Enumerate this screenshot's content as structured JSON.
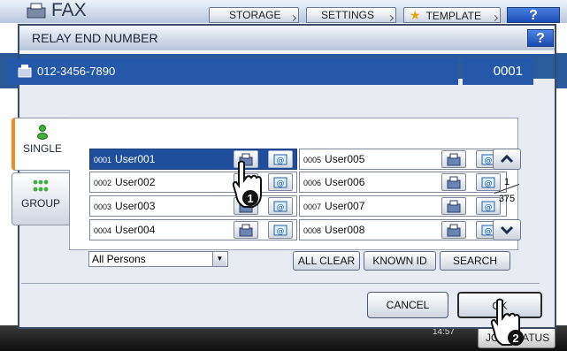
{
  "app": {
    "title": "FAX"
  },
  "top_tabs": [
    {
      "label": "STORAGE"
    },
    {
      "label": "SETTINGS"
    },
    {
      "label": "TEMPLATE"
    }
  ],
  "top_help_label": "?",
  "dialog": {
    "title": "RELAY END NUMBER",
    "help_label": "?",
    "destination": {
      "number": "012-3456-7890",
      "count": "0001"
    },
    "side_tabs": [
      {
        "label": "SINGLE",
        "icon": "person-icon",
        "active": true
      },
      {
        "label": "GROUP",
        "icon": "group-icon",
        "active": false
      }
    ],
    "entries": [
      {
        "num": "0001",
        "name": "User001",
        "selected": true
      },
      {
        "num": "0002",
        "name": "User002",
        "selected": false
      },
      {
        "num": "0003",
        "name": "User003",
        "selected": false
      },
      {
        "num": "0004",
        "name": "User004",
        "selected": false
      },
      {
        "num": "0005",
        "name": "User005",
        "selected": false
      },
      {
        "num": "0006",
        "name": "User006",
        "selected": false
      },
      {
        "num": "0007",
        "name": "User007",
        "selected": false
      },
      {
        "num": "0008",
        "name": "User008",
        "selected": false
      }
    ],
    "page": {
      "current": "1",
      "total": "375"
    },
    "filter": {
      "value": "All Persons"
    },
    "buttons": {
      "all_clear": "ALL CLEAR",
      "known_id": "KNOWN ID",
      "search": "SEARCH",
      "cancel": "CANCEL",
      "ok": "OK"
    },
    "callouts": [
      "1",
      "2"
    ]
  },
  "status_bar": {
    "job_label": "JOB STATUS",
    "time": "14:57"
  },
  "colors": {
    "accent_blue": "#2558a8",
    "selected_row": "#1f4f9c",
    "tab_marker": "#f08a1c"
  }
}
